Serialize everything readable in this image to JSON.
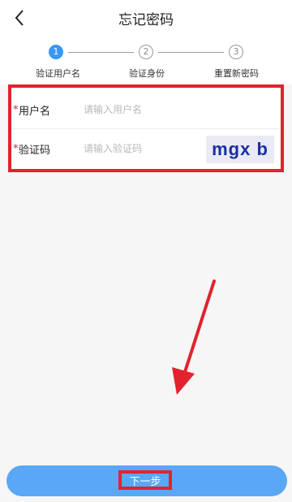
{
  "header": {
    "title": "忘记密码",
    "back_icon": "chevron-left-icon"
  },
  "steps": [
    {
      "number": "1",
      "label": "验证用户名",
      "state": "active"
    },
    {
      "number": "2",
      "label": "验证身份",
      "state": "inactive"
    },
    {
      "number": "3",
      "label": "重置新密码",
      "state": "inactive"
    }
  ],
  "form": {
    "username": {
      "required_mark": "*",
      "label": "用户名",
      "placeholder": "请输入用户名",
      "value": ""
    },
    "captcha": {
      "required_mark": "*",
      "label": "验证码",
      "placeholder": "请输入验证码",
      "value": "",
      "image_text": "mgx b"
    }
  },
  "footer": {
    "next_label": "下一步"
  },
  "colors": {
    "accent": "#3a97f5",
    "button": "#5aa7f6",
    "highlight": "#e2232e",
    "required": "#e2232e"
  }
}
